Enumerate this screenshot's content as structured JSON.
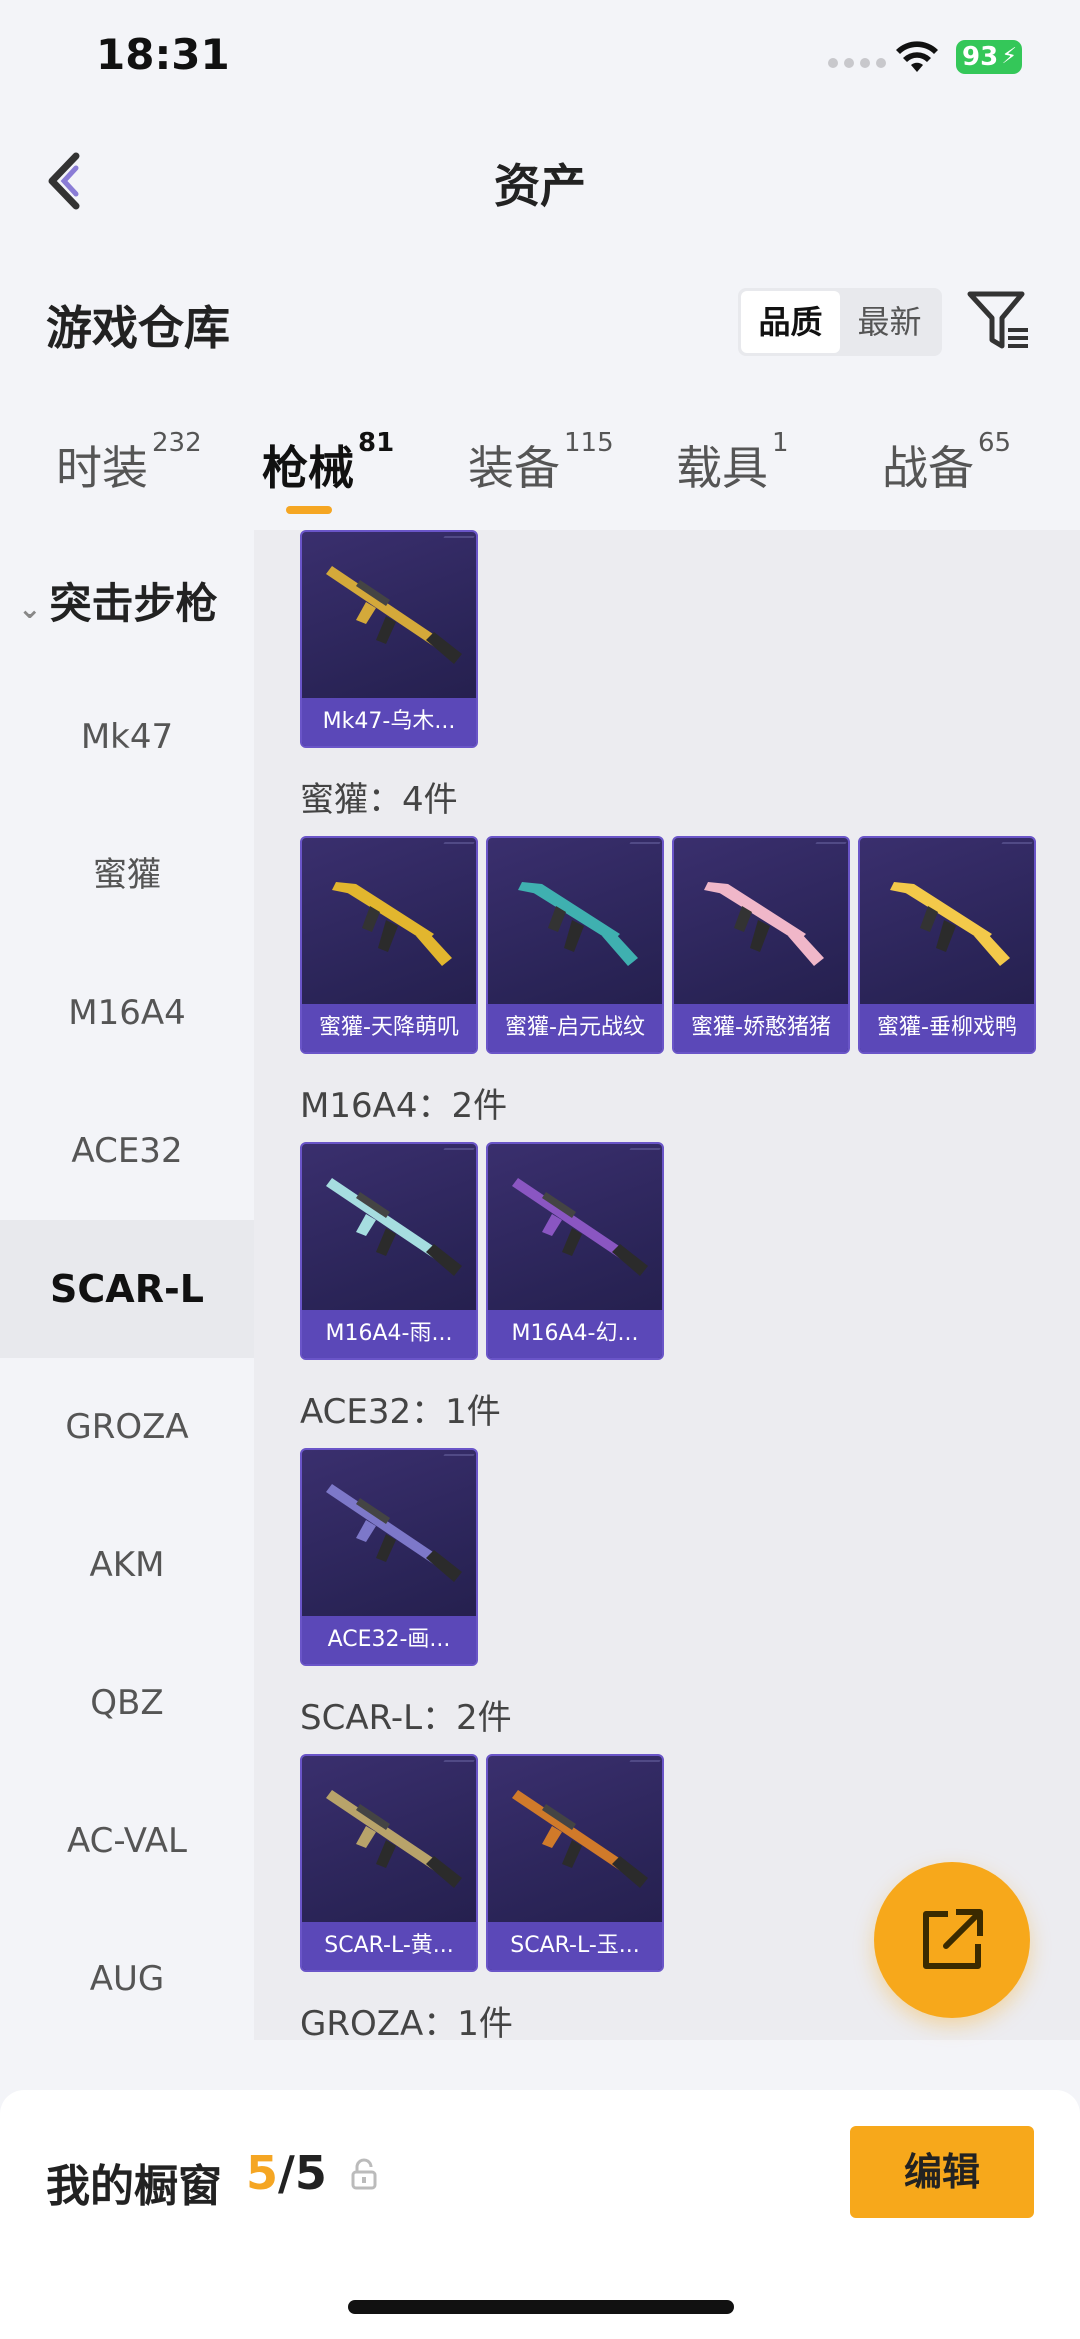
{
  "status": {
    "time": "18:31",
    "battery": "93"
  },
  "nav": {
    "title": "资产"
  },
  "header": {
    "title": "游戏仓库",
    "sort_options": [
      "品质",
      "最新"
    ]
  },
  "tabs": [
    {
      "label": "时装",
      "count": "232"
    },
    {
      "label": "枪械",
      "count": "81"
    },
    {
      "label": "装备",
      "count": "115"
    },
    {
      "label": "载具",
      "count": "1"
    },
    {
      "label": "战备",
      "count": "65"
    }
  ],
  "sidebar": {
    "category": "突击步枪",
    "items": [
      "Mk47",
      "蜜獾",
      "M16A4",
      "ACE32",
      "SCAR-L",
      "GROZA",
      "AKM",
      "QBZ",
      "AC-VAL",
      "AUG"
    ],
    "active": "SCAR-L"
  },
  "groups": [
    {
      "label": "",
      "cards": [
        "Mk47-乌木..."
      ]
    },
    {
      "label": "蜜獾：4件",
      "cards": [
        "蜜獾-天降萌叽",
        "蜜獾-启元战纹",
        "蜜獾-娇憨猪猪",
        "蜜獾-垂柳戏鸭"
      ]
    },
    {
      "label": "M16A4：2件",
      "cards": [
        "M16A4-雨...",
        "M16A4-幻..."
      ]
    },
    {
      "label": "ACE32：1件",
      "cards": [
        "ACE32-画..."
      ]
    },
    {
      "label": "SCAR-L：2件",
      "cards": [
        "SCAR-L-黄...",
        "SCAR-L-玉..."
      ]
    },
    {
      "label": "GROZA：1件",
      "cards": []
    }
  ],
  "gun_colors": [
    "#d4a93a",
    "#e2b62e",
    "#3fb0b0",
    "#f0b7c9",
    "#f3c94a",
    "#a6dde0",
    "#8a56c2",
    "#7d78c9",
    "#b8a36a",
    "#d07a2a"
  ],
  "showcase": {
    "title": "我的橱窗",
    "current": "5",
    "total": "/5",
    "edit_label": "编辑"
  }
}
